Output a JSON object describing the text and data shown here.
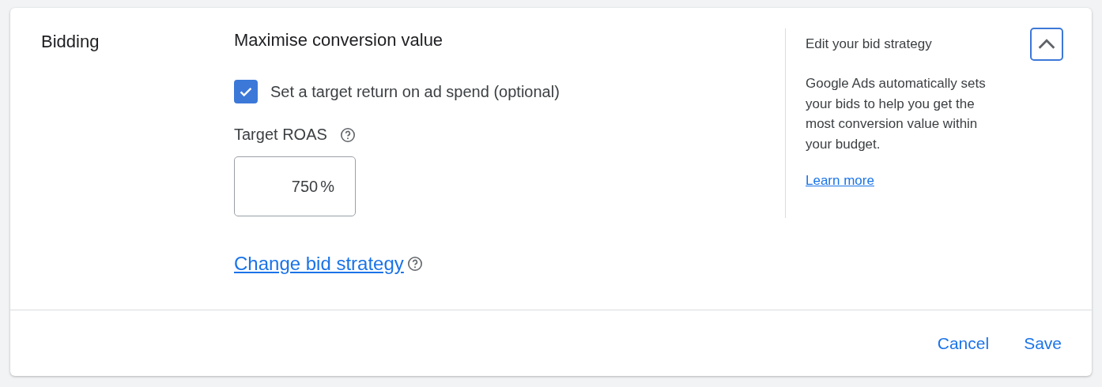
{
  "section": {
    "title": "Bidding",
    "expanded": true
  },
  "strategy": {
    "title": "Maximise conversion value",
    "target_option": {
      "label": "Set a target return on ad spend (optional)",
      "checked": true
    },
    "target_roas": {
      "label": "Target ROAS",
      "value": "750",
      "unit": "%"
    },
    "change_link": "Change bid strategy"
  },
  "help": {
    "title": "Edit your bid strategy",
    "body": "Google Ads automatically sets your bids to help you get the most conversion value within your budget.",
    "link": "Learn more"
  },
  "buttons": [
    "Cancel",
    "Save"
  ]
}
